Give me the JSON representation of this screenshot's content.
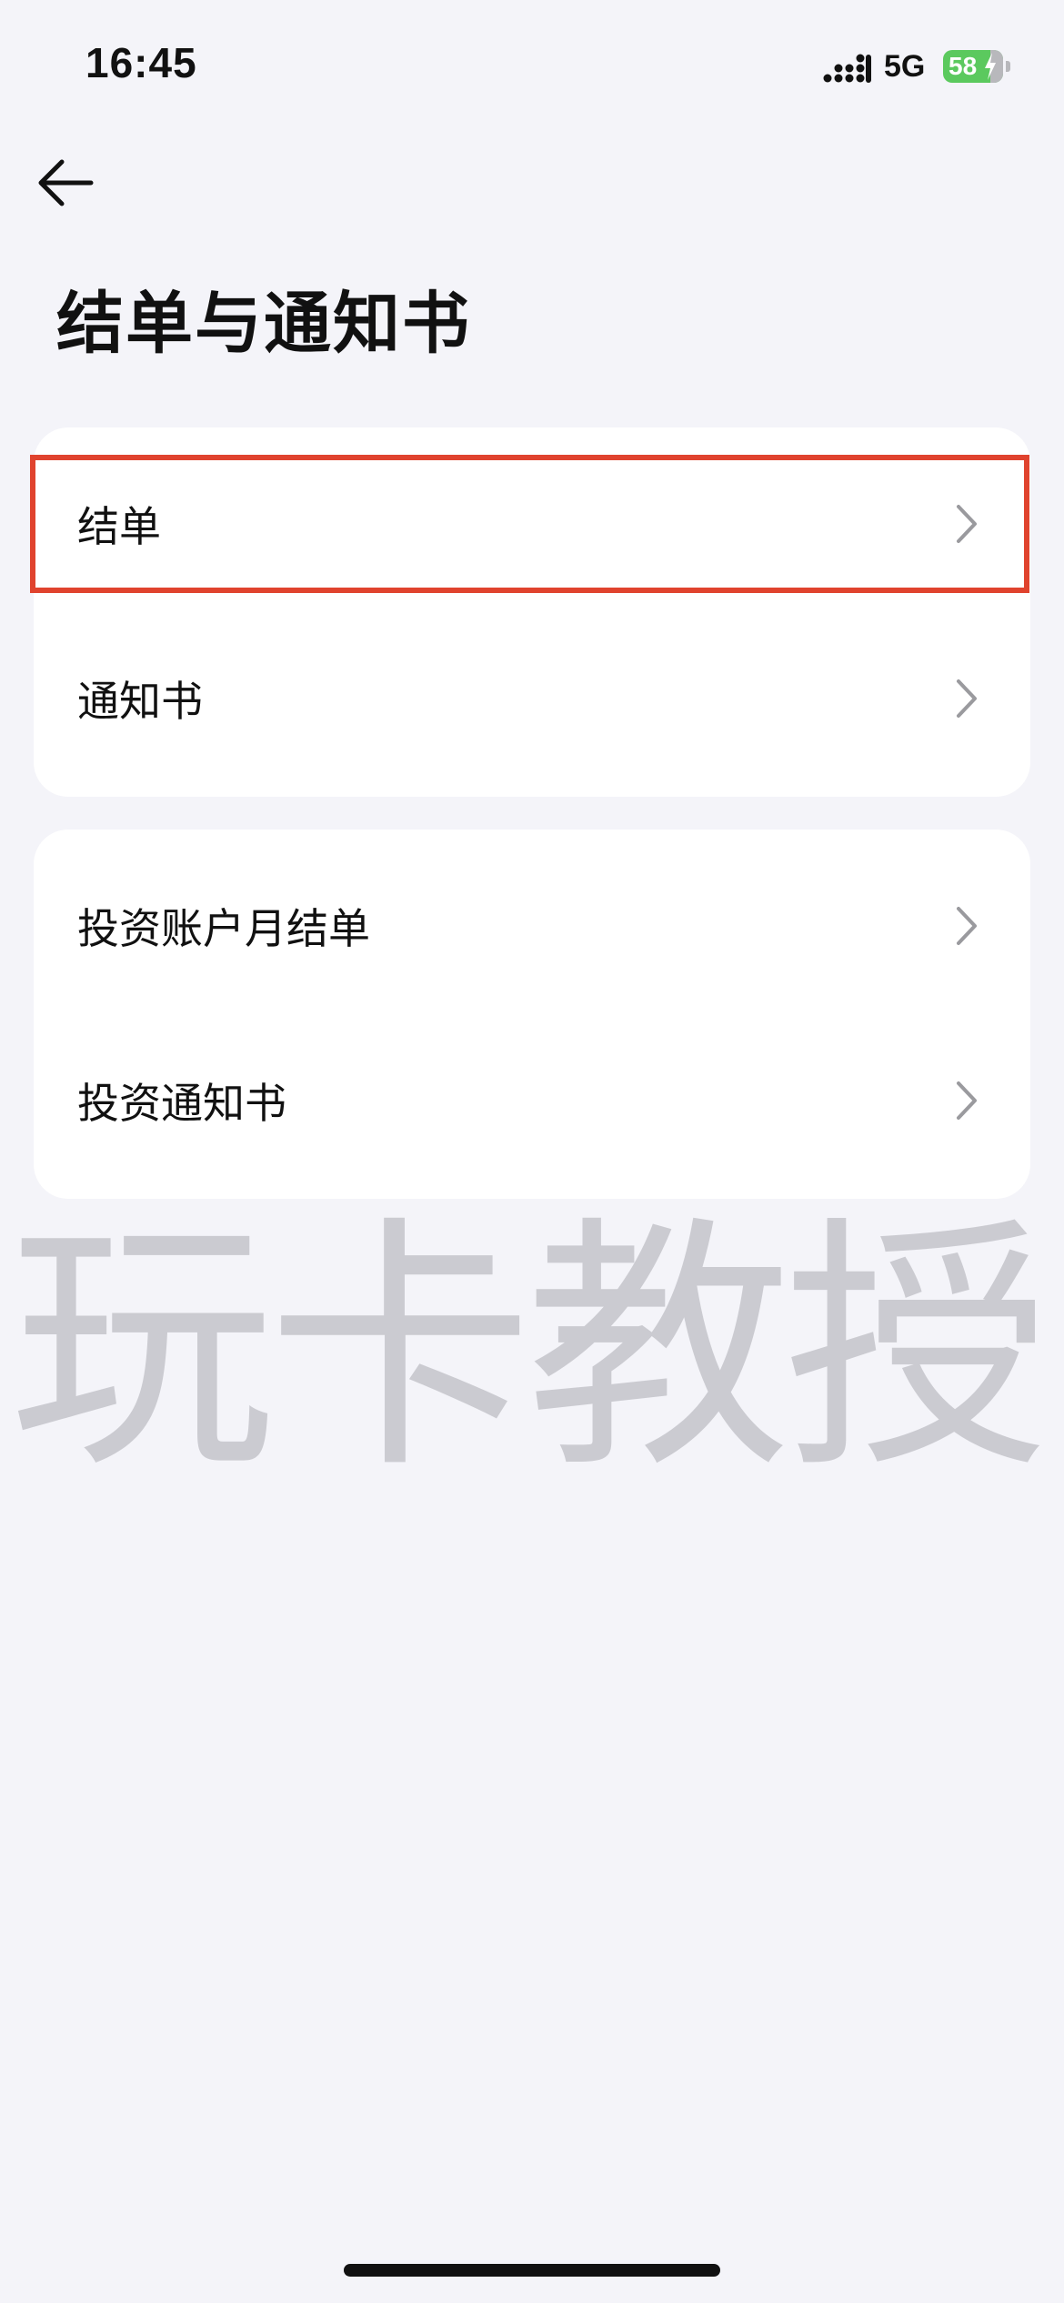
{
  "status_bar": {
    "time": "16:45",
    "network": "5G",
    "battery": "58",
    "signal_icon": "signal-icon",
    "battery_icon": "battery-charging-icon"
  },
  "header": {
    "back_icon": "arrow-left-icon",
    "title": "结单与通知书"
  },
  "groups": [
    {
      "items": [
        {
          "label": "结单",
          "icon": "chevron-right-icon"
        },
        {
          "label": "通知书",
          "icon": "chevron-right-icon"
        }
      ]
    },
    {
      "items": [
        {
          "label": "投资账户月结单",
          "icon": "chevron-right-icon"
        },
        {
          "label": "投资通知书",
          "icon": "chevron-right-icon"
        }
      ]
    }
  ],
  "watermark": "玩卡教授",
  "colors": {
    "background": "#f4f4f9",
    "card": "#ffffff",
    "highlight": "#e0432e",
    "battery": "#5bc95e",
    "chevron": "#9a9a9e"
  }
}
